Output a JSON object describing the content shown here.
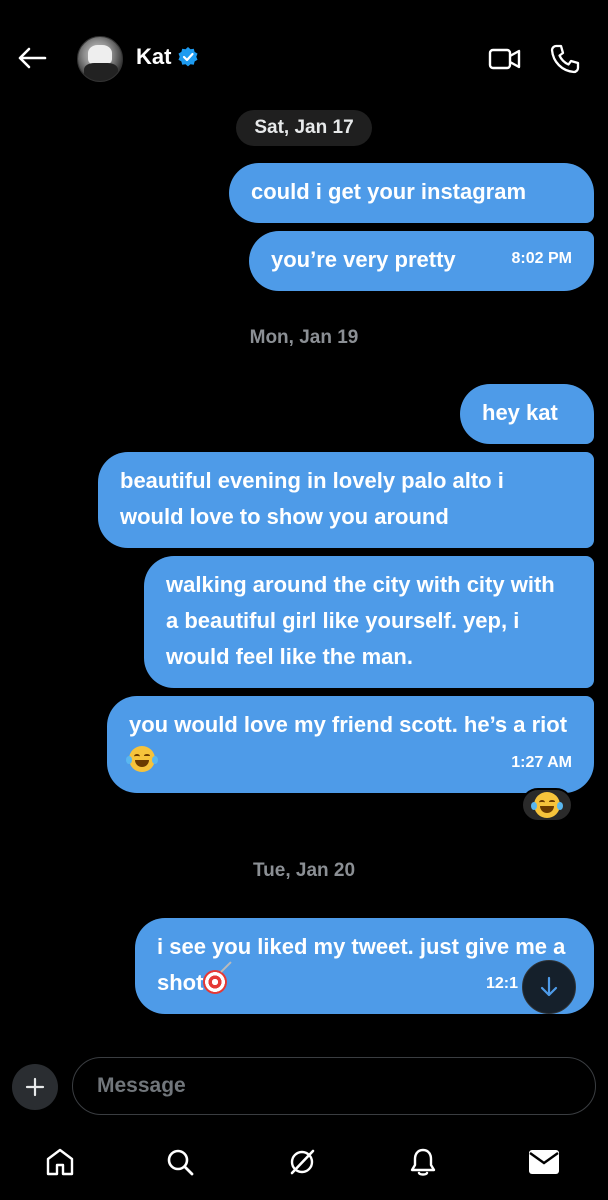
{
  "header": {
    "title": "Kat",
    "back_icon": "arrow-left-icon",
    "video_icon": "video-icon",
    "phone_icon": "phone-icon",
    "verified_color": "#1d9bf0"
  },
  "dates": {
    "d1": "Sat, Jan 17",
    "d2": "Mon, Jan 19",
    "d3": "Tue, Jan 20"
  },
  "messages": [
    {
      "text": "could i get your instagram",
      "time": ""
    },
    {
      "text": "you’re very pretty",
      "time": "8:02 PM"
    },
    {
      "text": "hey kat",
      "time": ""
    },
    {
      "text": "beautiful evening in lovely palo alto i would love to show you around",
      "time": ""
    },
    {
      "text": "walking around the city with city with a beautiful girl like yourself. yep, i would feel like the man.",
      "time": ""
    },
    {
      "text": "you would love my friend scott. he’s a riot",
      "time": "1:27 AM",
      "emoji": "laughing-tears"
    },
    {
      "text": "i see you liked my tweet. just give me a shot",
      "time": "12:1",
      "emoji": "dart-target"
    }
  ],
  "reaction": {
    "emoji": "laughing-tears"
  },
  "composer": {
    "placeholder": "Message",
    "add_icon": "plus-icon"
  },
  "nav": {
    "items": [
      "home-icon",
      "search-icon",
      "grok-icon",
      "notifications-icon",
      "messages-icon"
    ]
  },
  "colors": {
    "bubble": "#4e9be8",
    "background": "#000000"
  }
}
